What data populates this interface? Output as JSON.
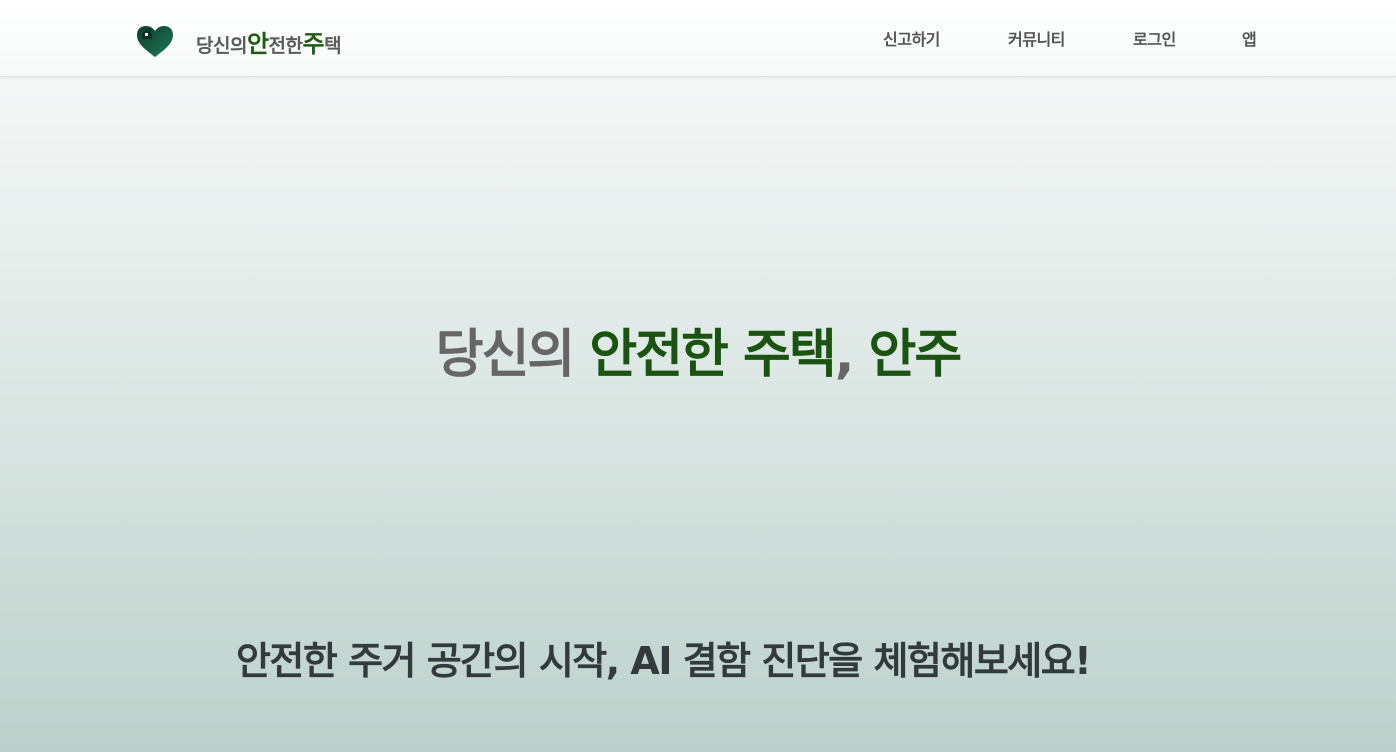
{
  "colors": {
    "brand_green": "#1a5410",
    "heart_dark": "#0d3b2e",
    "heart_light": "#1f7a55",
    "gray_text": "#666666",
    "dark_text": "#333a3e"
  },
  "header": {
    "logo_icon": "heart-house-icon",
    "brand": {
      "part1": "당신의 ",
      "hl1": "안",
      "part2": "전한 ",
      "hl2": "주",
      "part3": "택"
    },
    "nav": [
      {
        "label": "신고하기"
      },
      {
        "label": "커뮤니티"
      },
      {
        "label": "로그인"
      },
      {
        "label": "앱"
      }
    ]
  },
  "hero": {
    "title": {
      "part1": "당신의 ",
      "green1": "안전한 주택",
      "part2": ", ",
      "green2": "안주"
    },
    "subtitle": "안전한 주거 공간의 시작, AI 결함 진단을 체험해보세요!"
  }
}
